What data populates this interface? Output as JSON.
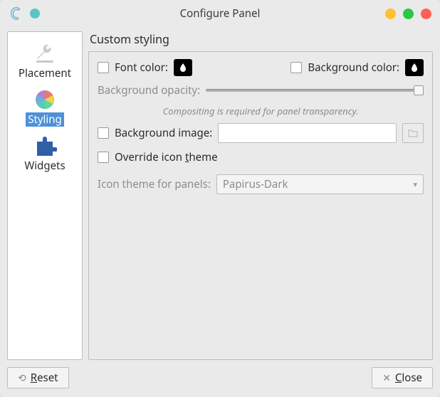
{
  "window": {
    "title": "Configure Panel"
  },
  "sidebar": {
    "items": [
      {
        "label": "Placement"
      },
      {
        "label": "Styling"
      },
      {
        "label": "Widgets"
      }
    ]
  },
  "section": {
    "title": "Custom styling"
  },
  "styling": {
    "font_color_label": "Font color:",
    "bg_color_label": "Background color:",
    "opacity_label": "Background opacity:",
    "opacity_hint": "Compositing is required for panel transparency.",
    "bg_image_label": "Background image:",
    "bg_image_value": "",
    "override_label_pre": "Override icon ",
    "override_label_mnem": "t",
    "override_label_post": "heme",
    "icon_theme_label": "Icon theme for panels:",
    "icon_theme_value": "Papirus-Dark"
  },
  "footer": {
    "reset_mnem": "R",
    "reset_post": "eset",
    "close_mnem": "C",
    "close_post": "lose"
  }
}
